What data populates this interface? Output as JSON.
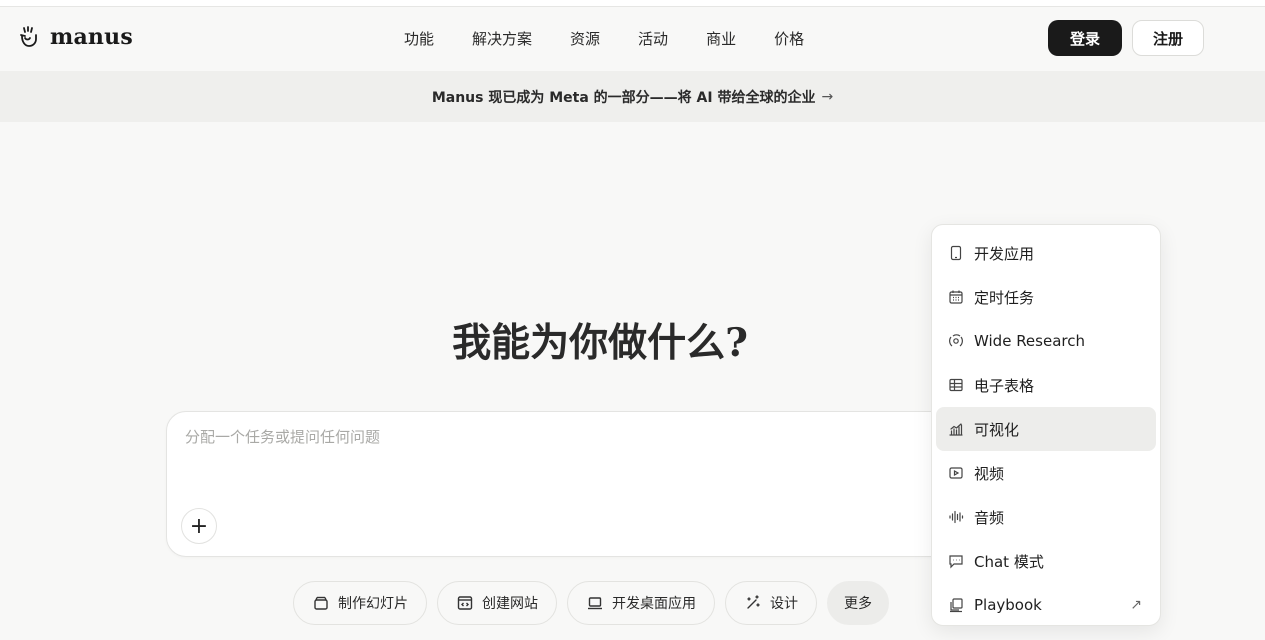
{
  "brand": {
    "name": "manus",
    "logo_icon": "manus-hand-icon"
  },
  "nav": {
    "items": [
      "功能",
      "解决方案",
      "资源",
      "活动",
      "商业",
      "价格"
    ]
  },
  "auth": {
    "login_label": "登录",
    "register_label": "注册"
  },
  "banner": {
    "text": "Manus 现已成为 Meta 的一部分——将 AI 带给全球的企业",
    "arrow": "→"
  },
  "main": {
    "headline": "我能为你做什么?"
  },
  "composer": {
    "placeholder": "分配一个任务或提问任何问题",
    "value": "",
    "add_label": "+"
  },
  "chips": [
    {
      "label": "制作幻灯片",
      "icon": "slides-icon"
    },
    {
      "label": "创建网站",
      "icon": "website-icon"
    },
    {
      "label": "开发桌面应用",
      "icon": "laptop-icon"
    },
    {
      "label": "设计",
      "icon": "design-wand-icon"
    },
    {
      "label": "更多",
      "icon": ""
    }
  ],
  "more_menu": {
    "items": [
      {
        "label": "开发应用",
        "icon": "phone-icon"
      },
      {
        "label": "定时任务",
        "icon": "calendar-icon"
      },
      {
        "label": "Wide Research",
        "icon": "wide-research-icon"
      },
      {
        "label": "电子表格",
        "icon": "spreadsheet-icon"
      },
      {
        "label": "可视化",
        "icon": "chart-icon",
        "highlighted": true
      },
      {
        "label": "视频",
        "icon": "video-icon"
      },
      {
        "label": "音频",
        "icon": "audio-wave-icon"
      },
      {
        "label": "Chat 模式",
        "icon": "chat-icon"
      },
      {
        "label": "Playbook",
        "icon": "playbook-icon",
        "external_arrow": "↗"
      }
    ]
  },
  "colors": {
    "background": "#f8f8f7",
    "banner": "#efefed",
    "primary_button": "#1a1a1a",
    "menu_highlight": "#ededeb"
  }
}
